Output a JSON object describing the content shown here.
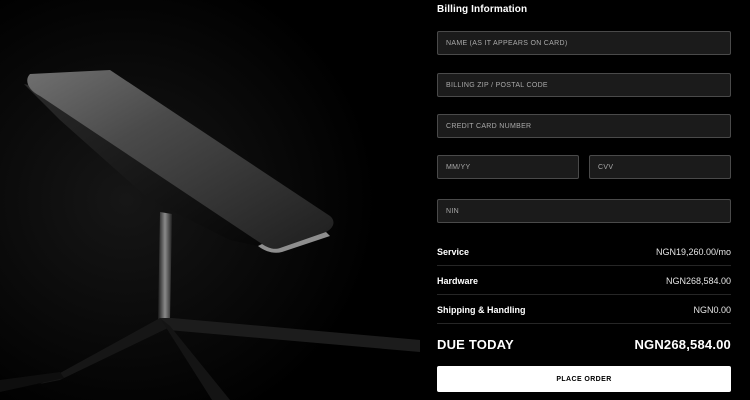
{
  "billing": {
    "title": "Billing Information",
    "fields": {
      "name": {
        "placeholder": "NAME (AS IT APPEARS ON CARD)",
        "value": ""
      },
      "zip": {
        "placeholder": "BILLING ZIP / POSTAL CODE",
        "value": ""
      },
      "card": {
        "placeholder": "CREDIT CARD NUMBER",
        "value": ""
      },
      "expiry": {
        "placeholder": "MM/YY",
        "value": ""
      },
      "cvv": {
        "placeholder": "CVV",
        "value": ""
      },
      "nin": {
        "placeholder": "NIN",
        "value": ""
      }
    }
  },
  "summary": {
    "service": {
      "label": "Service",
      "value": "NGN19,260.00/mo"
    },
    "hardware": {
      "label": "Hardware",
      "value": "NGN268,584.00"
    },
    "shipping": {
      "label": "Shipping & Handling",
      "value": "NGN0.00"
    },
    "due": {
      "label": "DUE TODAY",
      "value": "NGN268,584.00"
    }
  },
  "actions": {
    "place_order_label": "PLACE ORDER"
  },
  "colors": {
    "background": "#000000",
    "field_bg": "#1b1b1b",
    "field_border": "#4a4a4a",
    "button_bg": "#ffffff"
  },
  "hero": {
    "image": "satellite-dish-product-image"
  }
}
